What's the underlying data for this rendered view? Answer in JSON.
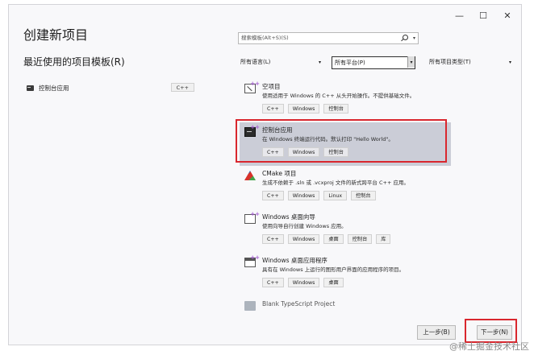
{
  "window": {
    "controls": [
      "—",
      "☐",
      "✕"
    ]
  },
  "page_title": "创建新项目",
  "recent": {
    "title": "最近使用的项目模板(R)",
    "items": [
      {
        "name": "控制台应用",
        "lang": "C++"
      }
    ]
  },
  "search": {
    "placeholder": "搜索模板(Alt+S)(S)"
  },
  "filters": {
    "language": "所有语言(L)",
    "platform": "所有平台(P)",
    "project_type": "所有项目类型(T)"
  },
  "templates": [
    {
      "name": "空项目",
      "desc": "使用适用于 Windows 的 C++ 从头开始操作。不提供基础文件。",
      "tags": [
        "C++",
        "Windows",
        "控制台"
      ],
      "icon": "empty-project-icon",
      "selected": false
    },
    {
      "name": "控制台应用",
      "desc": "在 Windows 终端运行代码。默认打印 \"Hello World\"。",
      "tags": [
        "C++",
        "Windows",
        "控制台"
      ],
      "icon": "console-app-icon",
      "selected": true
    },
    {
      "name": "CMake 项目",
      "desc": "生成不依赖于 .sln 或 .vcxproj 文件的新式跨平台 C++ 应用。",
      "tags": [
        "C++",
        "Windows",
        "Linux",
        "控制台"
      ],
      "icon": "cmake-icon",
      "selected": false
    },
    {
      "name": "Windows 桌面向导",
      "desc": "使用向导自行创建 Windows 应用。",
      "tags": [
        "C++",
        "Windows",
        "桌面",
        "控制台",
        "库"
      ],
      "icon": "wizard-icon",
      "selected": false
    },
    {
      "name": "Windows 桌面应用程序",
      "desc": "具有在 Windows 上运行的图形用户界面的应用程序的项目。",
      "tags": [
        "C++",
        "Windows",
        "桌面"
      ],
      "icon": "desktop-app-icon",
      "selected": false
    },
    {
      "name": "Blank TypeScript Project",
      "desc": "",
      "tags": [],
      "icon": "typescript-icon",
      "selected": false
    }
  ],
  "buttons": {
    "prev": "上一步(B)",
    "next": "下一步(N)"
  },
  "watermark": "@稀土掘金技术社区",
  "colors": {
    "highlight": "#d9272e",
    "selected_bg": "#cbcdd7"
  }
}
